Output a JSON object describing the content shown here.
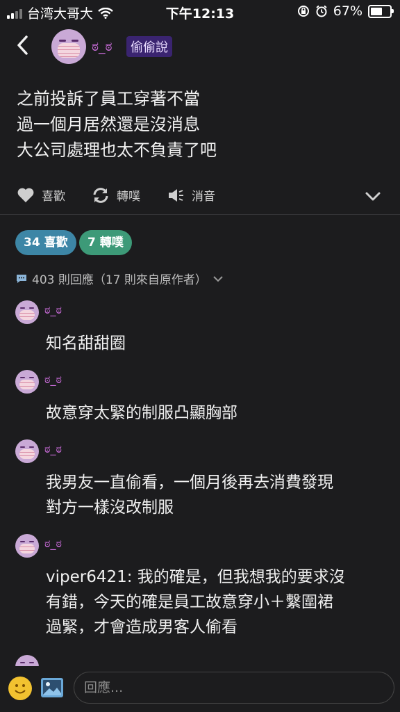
{
  "status_bar": {
    "carrier": "台湾大哥大",
    "time": "下午12:13",
    "battery": "67%",
    "battery_level": 0.67
  },
  "header": {
    "author": "ಠ_ಠ",
    "badge": "偷偷說",
    "back_icon": "chevron-left-icon"
  },
  "post": {
    "lines": [
      "之前投訴了員工穿著不當",
      "過一個月居然還是沒消息",
      "大公司處理也太不負責了吧"
    ]
  },
  "actions": {
    "like": "喜歡",
    "repost": "轉噗",
    "mute": "消音"
  },
  "stats": {
    "likes": "34 喜歡",
    "reposts": "7 轉噗"
  },
  "replies": {
    "summary": "403 則回應（17 則來自原作者）"
  },
  "comments": [
    {
      "name": "ಠ_ಠ",
      "lines": [
        "知名甜甜圈"
      ]
    },
    {
      "name": "ಠ_ಠ",
      "lines": [
        "故意穿太緊的制服凸顯胸部"
      ]
    },
    {
      "name": "ಠ_ಠ",
      "lines": [
        "我男友一直偷看，一個月後再去消費發現",
        "對方一樣沒改制服"
      ]
    },
    {
      "name": "ಠ_ಠ",
      "lines": [
        "viper6421: 我的確是，但我想我的要求沒",
        "有錯，今天的確是員工故意穿小＋繫圍裙",
        "過緊，才會造成男客人偷看"
      ]
    }
  ],
  "composer": {
    "placeholder": "回應..."
  },
  "colors": {
    "background": "#1c1c1e",
    "name": "#c86bd8",
    "like_pill": "#3d86a6",
    "repost_pill": "#3d9a78"
  }
}
